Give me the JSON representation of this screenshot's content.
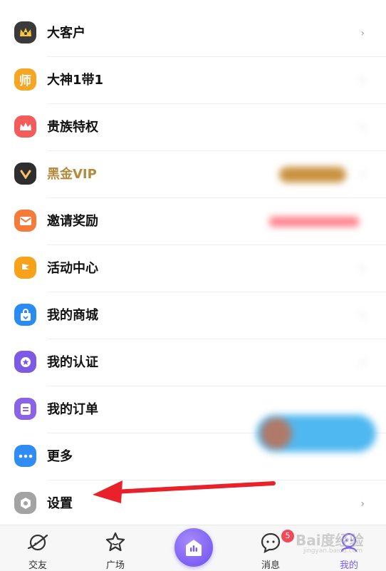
{
  "menu": [
    {
      "label": "大客户",
      "icon": "crown-icon",
      "color": "#3a3a3a",
      "chevron": "›"
    },
    {
      "label": "大神1带1",
      "icon": "master-icon",
      "color": "#f5a623",
      "chevron": "›"
    },
    {
      "label": "贵族特权",
      "icon": "noble-crown-icon",
      "color": "#f45b5b",
      "chevron": "›"
    },
    {
      "label": "黑金VIP",
      "icon": "vip-icon",
      "color": "#2e2e2e",
      "chevron": "›",
      "label_color": "#b48a3c"
    },
    {
      "label": "邀请奖励",
      "icon": "envelope-icon",
      "color": "#f57b3b",
      "chevron": "›"
    },
    {
      "label": "活动中心",
      "icon": "flag-icon",
      "color": "#f7a21b",
      "chevron": "›"
    },
    {
      "label": "我的商城",
      "icon": "shopping-bag-icon",
      "color": "#2a8cf3",
      "chevron": "›"
    },
    {
      "label": "我的认证",
      "icon": "certification-icon",
      "color": "#7d5ae6",
      "chevron": "›"
    },
    {
      "label": "我的订单",
      "icon": "order-icon",
      "color": "#8a63e8",
      "chevron": "›"
    },
    {
      "label": "更多",
      "icon": "more-dots-icon",
      "color": "#2f8cf5",
      "chevron": "›"
    },
    {
      "label": "设置",
      "icon": "settings-icon",
      "color": "#9a9a9a",
      "chevron": "›"
    }
  ],
  "tabs": [
    {
      "label": "交友",
      "icon": "planet-icon"
    },
    {
      "label": "广场",
      "icon": "star-face-icon"
    },
    {
      "label": "消息",
      "icon": "chat-bubble-icon",
      "badge": "5"
    },
    {
      "label": "我的",
      "icon": "profile-icon",
      "active_color": "#7b5cf0"
    }
  ],
  "watermark": {
    "text": "Bai度经验",
    "sub": "jingyan.baidu.com"
  }
}
